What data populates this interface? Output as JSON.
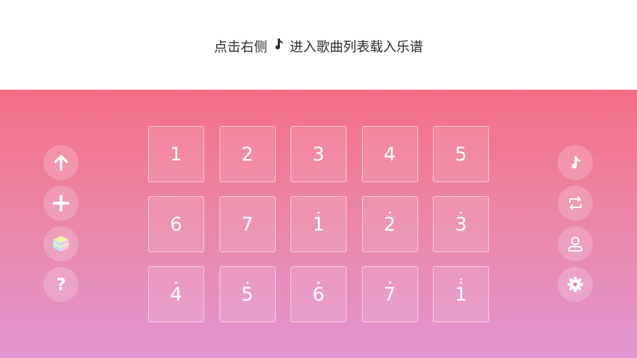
{
  "banner": {
    "hint_before": "点击右侧",
    "hint_after": "进入歌曲列表载入乐谱"
  },
  "left_toolbar": [
    {
      "name": "up-arrow-icon"
    },
    {
      "name": "plus-icon"
    },
    {
      "name": "color-cube-icon"
    },
    {
      "name": "help-icon",
      "label": "?"
    }
  ],
  "right_toolbar": [
    {
      "name": "music-note-icon"
    },
    {
      "name": "repeat-icon"
    },
    {
      "name": "user-icon"
    },
    {
      "name": "gear-icon"
    }
  ],
  "keys": [
    {
      "label": "1",
      "dots": 0
    },
    {
      "label": "2",
      "dots": 0
    },
    {
      "label": "3",
      "dots": 0
    },
    {
      "label": "4",
      "dots": 0
    },
    {
      "label": "5",
      "dots": 0
    },
    {
      "label": "6",
      "dots": 0
    },
    {
      "label": "7",
      "dots": 0
    },
    {
      "label": "1",
      "dots": 1
    },
    {
      "label": "2",
      "dots": 1
    },
    {
      "label": "3",
      "dots": 1
    },
    {
      "label": "4",
      "dots": 1
    },
    {
      "label": "5",
      "dots": 1
    },
    {
      "label": "6",
      "dots": 1
    },
    {
      "label": "7",
      "dots": 1
    },
    {
      "label": "1",
      "dots": 2
    }
  ],
  "colors": {
    "gradient_top": "#f46e85",
    "gradient_bottom": "#e296d2",
    "banner_bg": "#ffffff",
    "hint_text": "#2b2b2b"
  }
}
